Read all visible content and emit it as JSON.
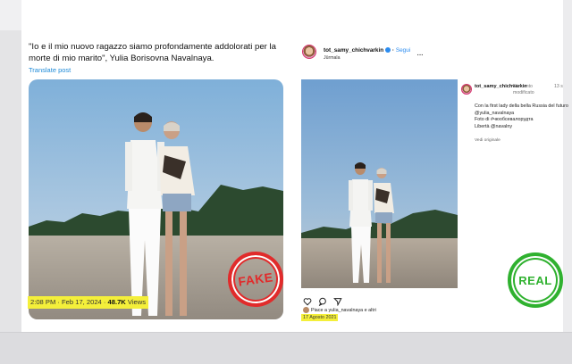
{
  "tweet": {
    "text": "\"Io e il mio nuovo ragazzo siamo profondamente addolorati per la morte di mio marito\", Yulia Borisovna Navalnaya.",
    "translate_label": "Translate post",
    "time": "2:08 PM · Feb 17, 2024 · ",
    "views_count": "48.7K",
    "views_label": " Views",
    "stamp": "FAKE"
  },
  "instagram": {
    "username": "tot_samy_chichvarkin",
    "follow_label": "Segui",
    "location": "Jūrmala",
    "more_icon": "···",
    "comment": {
      "username": "tot_samy_chichvarkin",
      "tag": "Elemento modificato",
      "time": "13 s",
      "body": "Con la first lady della bella Russia del futuro @yulia_navalnaya\nFoto di #чюобсевалорудта\nLibertà @navalny",
      "translate": "Vedi originale"
    },
    "likes_text": "Piace a yulia_navalnaya e altri",
    "date": "17 Agosto 2021",
    "stamp": "REAL"
  },
  "colors": {
    "highlight": "#f4ef3a",
    "fake": "#e12b2b",
    "real": "#2fb12f",
    "link": "#1d8ad8"
  }
}
